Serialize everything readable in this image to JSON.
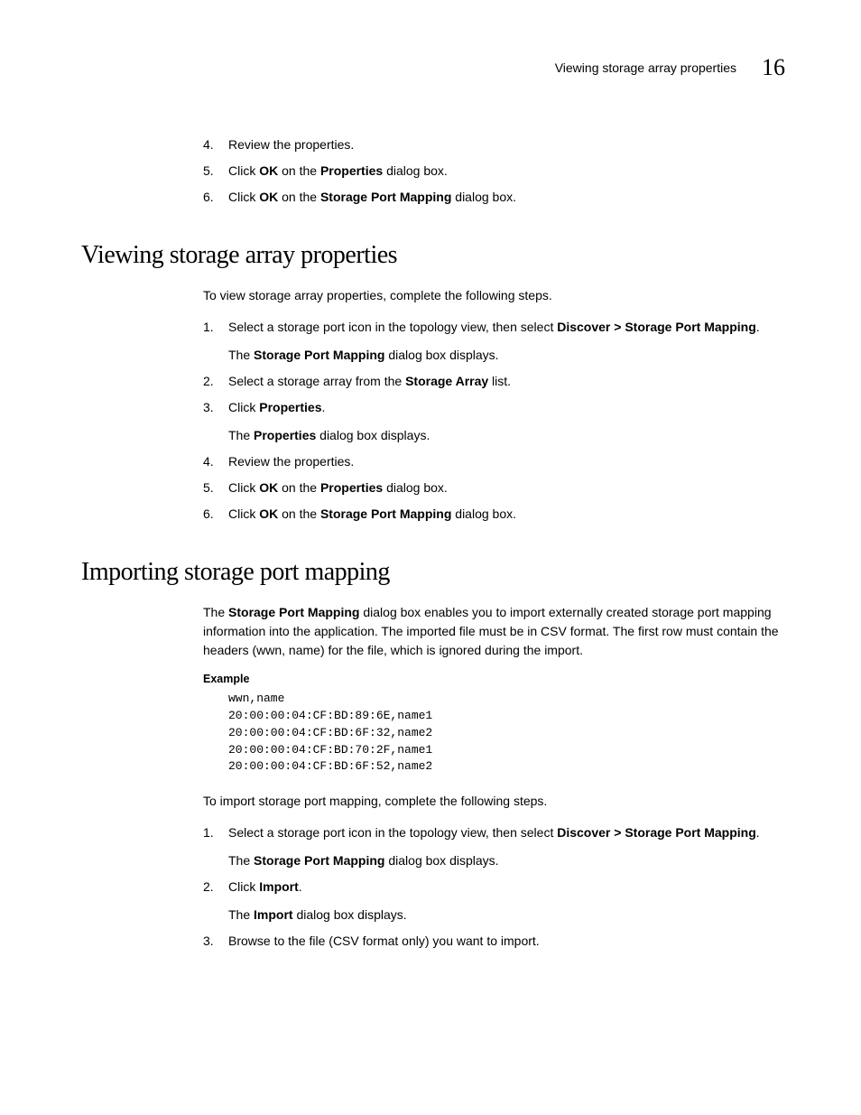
{
  "header": {
    "title": "Viewing storage array properties",
    "chapter": "16"
  },
  "topSteps": {
    "s4": "Review the properties.",
    "s5a": "Click ",
    "s5_ok": "OK",
    "s5b": " on the ",
    "s5_prop": "Properties",
    "s5c": " dialog box.",
    "s6a": "Click ",
    "s6_ok": "OK",
    "s6b": " on the ",
    "s6_spm": "Storage Port Mapping",
    "s6c": " dialog box."
  },
  "section1": {
    "heading": "Viewing storage array properties",
    "intro": "To view storage array properties, complete the following steps.",
    "s1a": "Select a storage port icon in the topology view, then select ",
    "s1_disc": "Discover > Storage Port Mapping",
    "s1b": ".",
    "s1suba": "The ",
    "s1sub_spm": "Storage Port Mapping",
    "s1subb": " dialog box displays.",
    "s2a": "Select a storage array from the ",
    "s2_sa": "Storage Array",
    "s2b": " list.",
    "s3a": "Click ",
    "s3_prop": "Properties",
    "s3b": ".",
    "s3suba": "The ",
    "s3sub_prop": "Properties",
    "s3subb": " dialog box displays.",
    "s4": "Review the properties.",
    "s5a": "Click ",
    "s5_ok": "OK",
    "s5b": " on the ",
    "s5_prop": "Properties",
    "s5c": " dialog box.",
    "s6a": "Click ",
    "s6_ok": "OK",
    "s6b": " on the ",
    "s6_spm": "Storage Port Mapping",
    "s6c": " dialog box."
  },
  "section2": {
    "heading": "Importing storage port mapping",
    "intro_a": "The ",
    "intro_spm": "Storage Port Mapping",
    "intro_b": " dialog box enables you to import externally created storage port mapping information into the application. The imported file must be in CSV format. The first row must contain the headers (wwn, name) for the file, which is ignored during the import.",
    "example_label": "Example",
    "code": "wwn,name\n20:00:00:04:CF:BD:89:6E,name1\n20:00:00:04:CF:BD:6F:32,name2\n20:00:00:04:CF:BD:70:2F,name1\n20:00:00:04:CF:BD:6F:52,name2",
    "intro2": "To import storage port mapping, complete the following steps.",
    "s1a": "Select a storage port icon in the topology view, then select ",
    "s1_disc": "Discover > Storage Port Mapping",
    "s1b": ".",
    "s1suba": "The ",
    "s1sub_spm": "Storage Port Mapping",
    "s1subb": " dialog box displays.",
    "s2a": "Click ",
    "s2_imp": "Import",
    "s2b": ".",
    "s2suba": "The ",
    "s2sub_imp": "Import",
    "s2subb": " dialog box displays.",
    "s3": "Browse to the file (CSV format only) you want to import."
  }
}
